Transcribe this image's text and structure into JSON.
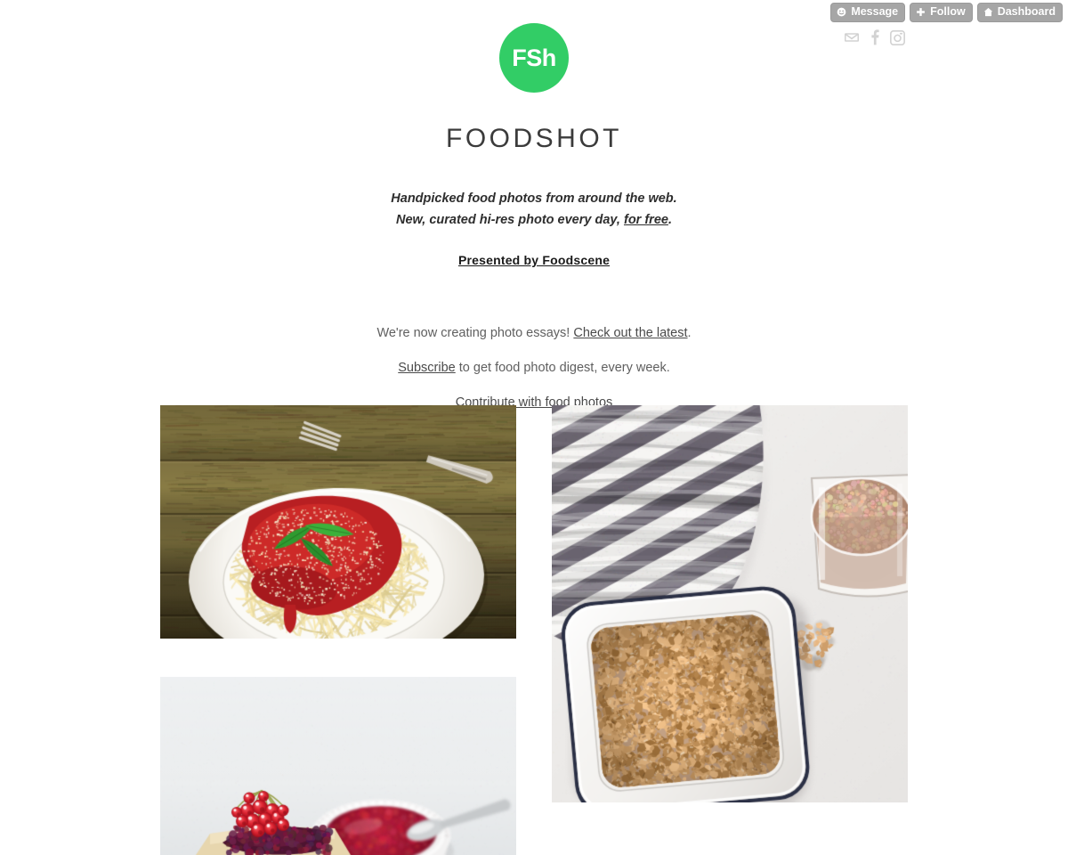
{
  "topbar": {
    "buttons": [
      {
        "label": "Message",
        "icon": "message-smiley-icon"
      },
      {
        "label": "Follow",
        "icon": "plus-icon"
      },
      {
        "label": "Dashboard",
        "icon": "house-icon"
      }
    ],
    "social": [
      {
        "name": "email-icon",
        "label": "Email"
      },
      {
        "name": "facebook-icon",
        "label": "Facebook"
      },
      {
        "name": "instagram-icon",
        "label": "Instagram"
      }
    ]
  },
  "header": {
    "logo_text": "FSh",
    "logo_color": "#32CD66",
    "title": "FOODSHOT",
    "tagline_line1": "Handpicked food photos from around the web.",
    "tagline_line2_pre": "New, curated hi-res photo every day, ",
    "tagline_line2_link": "for free",
    "tagline_line2_post": ".",
    "presented_by": "Presented by Foodscene"
  },
  "links": {
    "essays_pre": "We're now creating photo essays! ",
    "essays_link": "Check out the latest",
    "essays_post": ".",
    "subscribe_link": "Subscribe",
    "subscribe_post": " to get food photo digest, every week.",
    "contribute_link": "Contribute with food photos"
  },
  "gallery": {
    "photos": [
      {
        "id": "photo-spaghetti",
        "alt": "Spaghetti with tomato sauce, parmesan and basil on a white plate over rustic wood",
        "column": "left",
        "scene": "spaghetti"
      },
      {
        "id": "photo-granola",
        "alt": "Granola in a white enamel dish with striped towel and glass of latte",
        "column": "right",
        "scene": "granola"
      },
      {
        "id": "photo-berries",
        "alt": "Cake with red currants and berry sauce in a white ramekin with spoon",
        "column": "left",
        "scene": "berries"
      }
    ]
  }
}
